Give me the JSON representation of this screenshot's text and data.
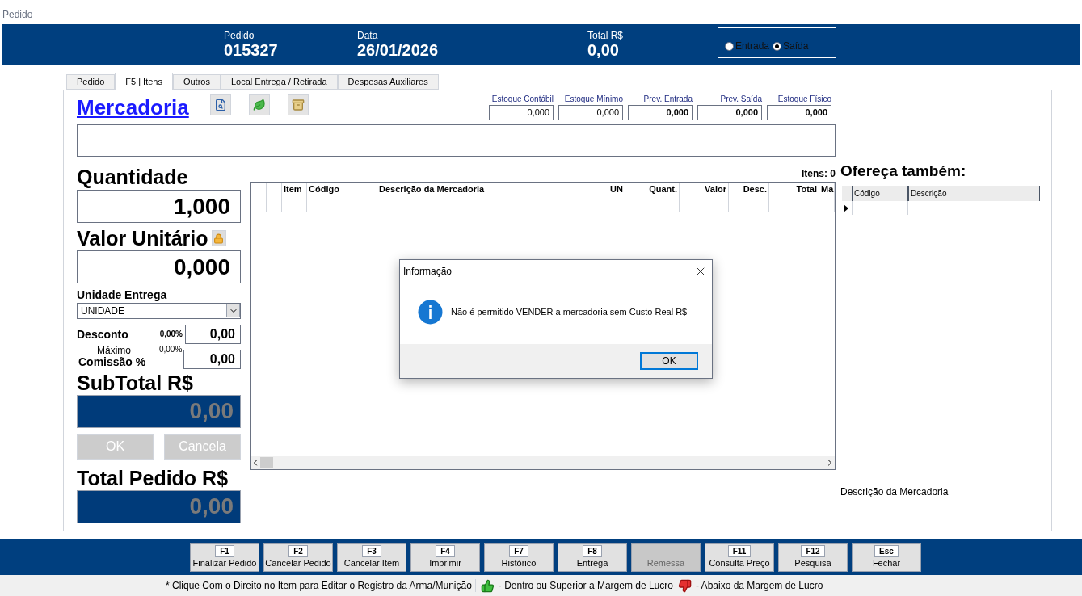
{
  "window": {
    "title": "Pedido"
  },
  "header": {
    "fields": [
      {
        "label": "Pedido",
        "value": "015327"
      },
      {
        "label": "Data",
        "value": "26/01/2026"
      },
      {
        "label": "Total R$",
        "value": "0,00"
      }
    ],
    "radios": [
      {
        "label": "Entrada",
        "selected": false
      },
      {
        "label": "Saída",
        "selected": true
      }
    ]
  },
  "tabs": [
    {
      "label": "Pedido",
      "selected": false
    },
    {
      "label": "F5 | Itens",
      "selected": true
    },
    {
      "label": "Outros",
      "selected": false
    },
    {
      "label": "Local Entrega  / Retirada",
      "selected": false
    },
    {
      "label": "Despesas Auxiliares",
      "selected": false
    }
  ],
  "product": {
    "title": "Mercadoria",
    "stock": [
      {
        "label": "Estoque Contábil",
        "value": "0,000",
        "bold": false
      },
      {
        "label": "Estoque Mínimo",
        "value": "0,000",
        "bold": false
      },
      {
        "label": "Prev. Entrada",
        "value": "0,000",
        "bold": true
      },
      {
        "label": "Prev. Saída",
        "value": "0,000",
        "bold": true
      },
      {
        "label": "Estoque Físico",
        "value": "0,000",
        "bold": true
      }
    ]
  },
  "quantity": {
    "label": "Quantidade",
    "value": "1,000"
  },
  "unit_price": {
    "label": "Valor Unitário",
    "value": "0,000"
  },
  "delivery_unit": {
    "label": "Unidade Entrega",
    "value": "UNIDADE"
  },
  "discount": {
    "label": "Desconto",
    "percent": "0,00%",
    "value": "0,00"
  },
  "maximum": {
    "label": "Máximo",
    "percent": "0,00%"
  },
  "commission": {
    "label": "Comissão %",
    "value": "0,00"
  },
  "subtotal": {
    "label": "SubTotal R$",
    "value": "0,00"
  },
  "item_buttons": [
    {
      "label": "OK",
      "disabled": true
    },
    {
      "label": "Cancela",
      "disabled": true
    }
  ],
  "total": {
    "label": "Total Pedido R$",
    "value": "0,00"
  },
  "items_grid": {
    "count": "Itens: 0",
    "columns": [
      {
        "label": "Item",
        "kind": "text"
      },
      {
        "label": "Código",
        "kind": "text"
      },
      {
        "label": "Descrição da Mercadoria",
        "kind": "text"
      },
      {
        "label": "UN",
        "kind": "text"
      },
      {
        "label": "Quant.",
        "kind": "number"
      },
      {
        "label": "Valor",
        "kind": "number"
      },
      {
        "label": "Desc.",
        "kind": "number"
      },
      {
        "label": "Total",
        "kind": "number"
      },
      {
        "label": "Ma",
        "kind": "text"
      }
    ]
  },
  "offer": {
    "title": "Ofereça também:",
    "columns": [
      "Código",
      "Descrição"
    ]
  },
  "description_label": "Descrição da Mercadoria",
  "function_keys": [
    {
      "key": "F1",
      "label": "Finalizar Pedido",
      "disabled": false
    },
    {
      "key": "F2",
      "label": "Cancelar Pedido",
      "disabled": false
    },
    {
      "key": "F3",
      "label": "Cancelar Item",
      "disabled": false
    },
    {
      "key": "F4",
      "label": "Imprimir",
      "disabled": false
    },
    {
      "key": "F7",
      "label": "Histórico",
      "disabled": false
    },
    {
      "key": "F8",
      "label": "Entrega",
      "disabled": false
    },
    {
      "label": "Remessa",
      "disabled": true
    },
    {
      "key": "F11",
      "label": "Consulta Preço",
      "disabled": false
    },
    {
      "key": "F12",
      "label": "Pesquisa",
      "disabled": false
    },
    {
      "key": "Esc",
      "label": "Fechar",
      "disabled": false
    }
  ],
  "status_bar": {
    "hint": "* Clique Com o Direito no Item para Editar o Registro da Arma/Munição",
    "legend": [
      {
        "kind": "up",
        "label": "- Dentro ou Superior a Margem de Lucro"
      },
      {
        "kind": "down",
        "label": "- Abaixo da Margem de Lucro"
      }
    ]
  },
  "dialog": {
    "title": "Informação",
    "message": "Não é permitido VENDER a mercadoria sem Custo Real R$",
    "button": "OK"
  }
}
